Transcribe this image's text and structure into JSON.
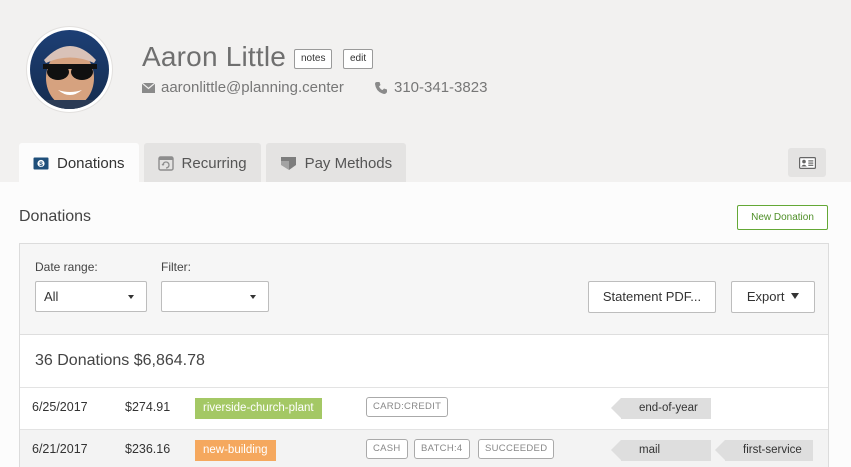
{
  "profile": {
    "name": "Aaron Little",
    "notes_label": "notes",
    "edit_label": "edit",
    "email": "aaronlittle@planning.center",
    "phone": "310-341-3823"
  },
  "tabs": [
    {
      "label": "Donations",
      "icon": "donation-icon",
      "active": true
    },
    {
      "label": "Recurring",
      "icon": "recurring-icon",
      "active": false
    },
    {
      "label": "Pay Methods",
      "icon": "pay-methods-icon",
      "active": false
    }
  ],
  "main": {
    "title": "Donations",
    "new_button": "New Donation",
    "filters": {
      "date_range_label": "Date range:",
      "date_range_value": "All",
      "filter_label": "Filter:",
      "filter_value": ""
    },
    "statement_button": "Statement PDF...",
    "export_button": "Export",
    "summary": "36 Donations $6,864.78",
    "rows": [
      {
        "date": "6/25/2017",
        "amount": "$274.91",
        "fund": "riverside-church-plant",
        "fund_color": "#a4c865",
        "badges": [
          "CARD:CREDIT"
        ],
        "labels": [
          "end-of-year"
        ]
      },
      {
        "date": "6/21/2017",
        "amount": "$236.16",
        "fund": "new-building",
        "fund_color": "#f5a85e",
        "badges": [
          "CASH",
          "BATCH:4",
          "SUCCEEDED"
        ],
        "labels": [
          "mail",
          "first-service"
        ]
      }
    ]
  },
  "colors": {
    "accent_green": "#64a836",
    "background": "#f2f1f0"
  }
}
